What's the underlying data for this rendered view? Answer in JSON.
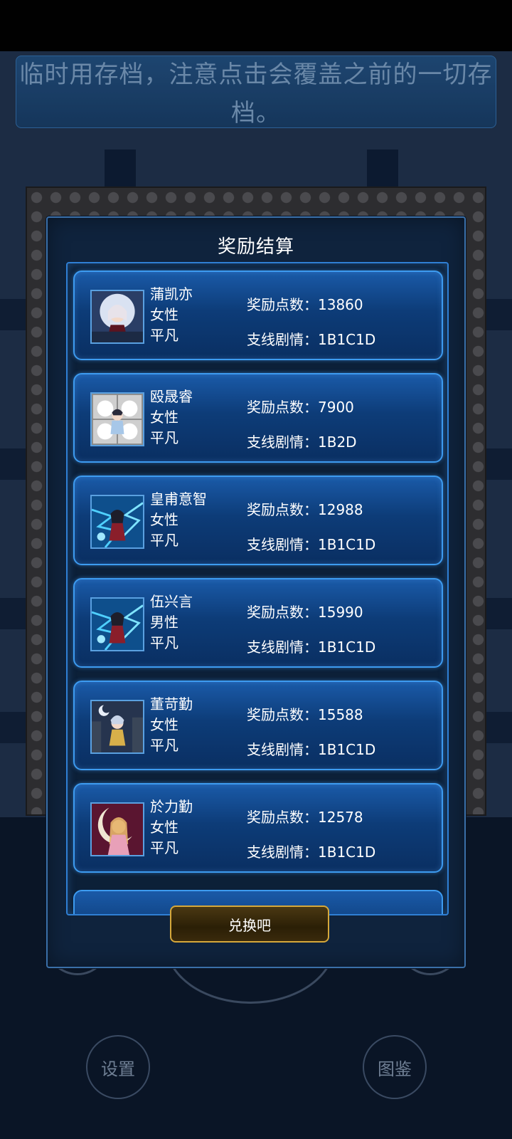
{
  "notice": "临时用存档，注意点击会覆盖之前的一切存档。",
  "modal": {
    "title": "奖励结算",
    "button": "兑换吧"
  },
  "labels": {
    "points": "奖励点数：",
    "branch": "支线剧情："
  },
  "rewards": [
    {
      "name": "蒲凯亦",
      "gender": "女性",
      "trait": "平凡",
      "points": "13860",
      "branch": "1B1C1D",
      "avatar": "portrait-moon-girl-icon"
    },
    {
      "name": "殴晟睿",
      "gender": "女性",
      "trait": "平凡",
      "points": "7900",
      "branch": "1B2D",
      "avatar": "portrait-cloud-girl-icon"
    },
    {
      "name": "皇甫意智",
      "gender": "女性",
      "trait": "平凡",
      "points": "12988",
      "branch": "1B1C1D",
      "avatar": "portrait-lightning-icon"
    },
    {
      "name": "伍兴言",
      "gender": "男性",
      "trait": "平凡",
      "points": "15990",
      "branch": "1B1C1D",
      "avatar": "portrait-lightning-icon"
    },
    {
      "name": "董苛勤",
      "gender": "女性",
      "trait": "平凡",
      "points": "15588",
      "branch": "1B1C1D",
      "avatar": "portrait-night-city-icon"
    },
    {
      "name": "於力勤",
      "gender": "女性",
      "trait": "平凡",
      "points": "12578",
      "branch": "1B1C1D",
      "avatar": "portrait-crescent-moon-icon"
    }
  ],
  "bottom_buttons": {
    "settings": "设置",
    "gallery": "图鉴"
  },
  "colors": {
    "card_border": "#3d9bf0",
    "button_border": "#d6a83a",
    "modal_bg": "#0f233d"
  }
}
